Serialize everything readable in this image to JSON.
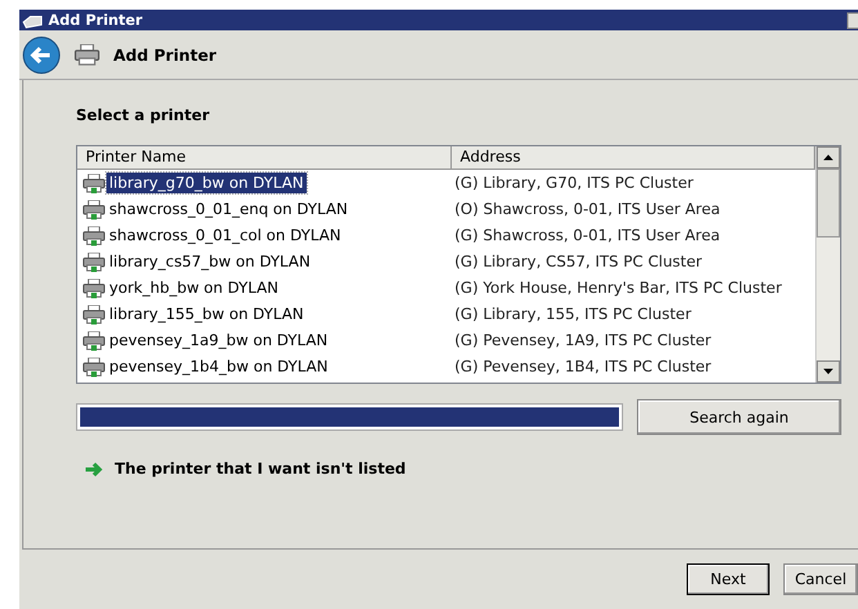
{
  "window": {
    "title": "Add Printer"
  },
  "header": {
    "title": "Add Printer"
  },
  "section_title": "Select a printer",
  "table": {
    "columns": [
      "Printer Name",
      "Address"
    ],
    "rows": [
      {
        "name": "library_g70_bw on DYLAN",
        "address": "(G) Library, G70, ITS PC Cluster",
        "selected": true
      },
      {
        "name": "shawcross_0_01_enq on DYLAN",
        "address": "(O) Shawcross, 0-01, ITS User Area",
        "selected": false
      },
      {
        "name": "shawcross_0_01_col on DYLAN",
        "address": "(G) Shawcross, 0-01, ITS User Area",
        "selected": false
      },
      {
        "name": "library_cs57_bw on DYLAN",
        "address": "(G) Library, CS57, ITS PC Cluster",
        "selected": false
      },
      {
        "name": "york_hb_bw on DYLAN",
        "address": "(G) York House, Henry's Bar,  ITS PC Cluster",
        "selected": false
      },
      {
        "name": "library_155_bw on DYLAN",
        "address": "(G) Library, 155, ITS PC Cluster",
        "selected": false
      },
      {
        "name": "pevensey_1a9_bw on DYLAN",
        "address": "(G) Pevensey, 1A9, ITS PC Cluster",
        "selected": false
      },
      {
        "name": "pevensey_1b4_bw on DYLAN",
        "address": "(G) Pevensey, 1B4, ITS PC Cluster",
        "selected": false
      }
    ]
  },
  "progress": {
    "level": 1
  },
  "search_button": "Search again",
  "not_listed_link": "The printer that I want isn't listed",
  "buttons": [
    {
      "label": "Next",
      "default": true
    },
    {
      "label": "Cancel",
      "default": false
    }
  ]
}
